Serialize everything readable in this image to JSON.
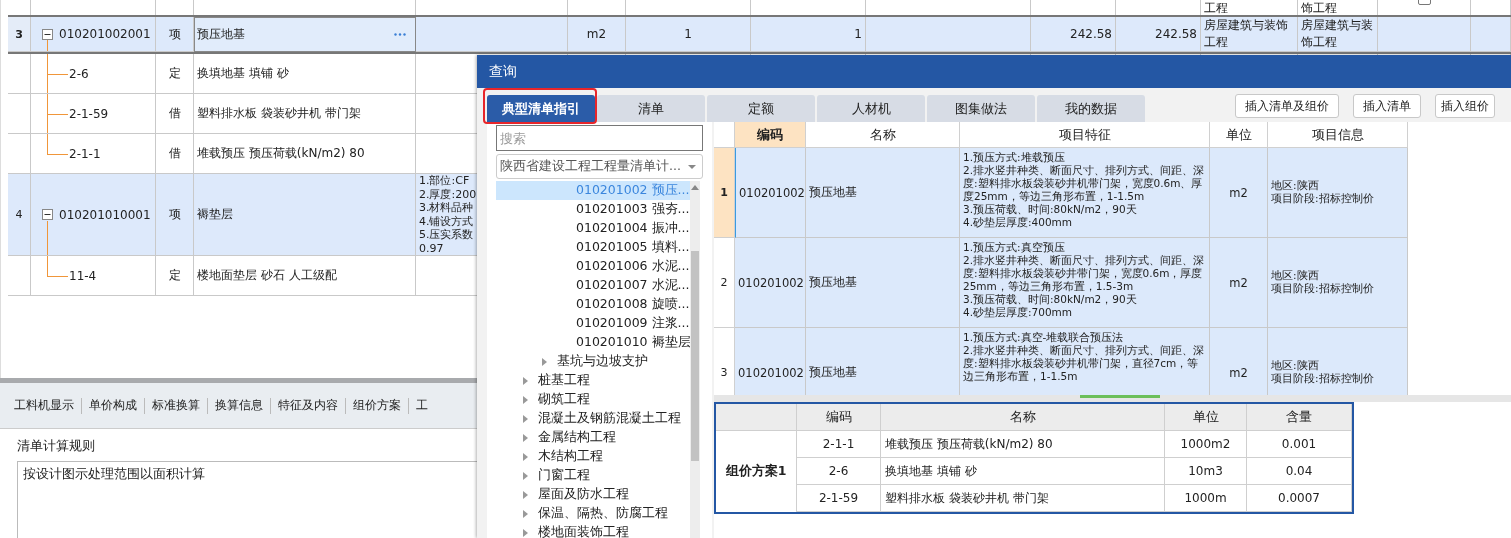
{
  "main_grid": {
    "top_row_fragment": {
      "column_12": "工程",
      "column_13": "饰工程",
      "checked": false
    },
    "rows": [
      {
        "index": "3",
        "code": "010201002001",
        "type": "项",
        "name": "预压地基",
        "kind": "bill",
        "selected": true,
        "expanded": true,
        "unit": "m2",
        "column_7": "1",
        "column_8": "1",
        "column_10": "242.58",
        "column_11": "242.58",
        "column_12": "房屋建筑与装饰工程",
        "column_13": "房屋建筑与装饰工程",
        "children": [
          {
            "code": "2-6",
            "type": "定",
            "name": "换填地基 填铺 砂",
            "kind": "quota",
            "selected": false
          },
          {
            "code": "2-1-59",
            "type": "借",
            "name": "塑料排水板 袋装砂井机 带门架",
            "kind": "quota",
            "selected": false
          },
          {
            "code": "2-1-1",
            "type": "借",
            "name": "堆载预压 预压荷载(kN/m2) 80",
            "kind": "quota",
            "selected": false
          }
        ]
      },
      {
        "index": "4",
        "code": "010201010001",
        "type": "项",
        "name": "褥垫层",
        "kind": "bill",
        "selected": false,
        "expanded": true,
        "feature": [
          "1.部位:CF",
          "2.厚度:200",
          "3.材料品种",
          "4.铺设方式",
          "5.压实系数",
          "0.97"
        ],
        "children": [
          {
            "code": "11-4",
            "type": "定",
            "name": "楼地面垫层 砂石 人工级配",
            "kind": "quota",
            "selected": false
          }
        ]
      }
    ]
  },
  "bottom_panel": {
    "tabs": [
      "工料机显示",
      "单价构成",
      "标准换算",
      "换算信息",
      "特征及内容",
      "组价方案",
      "工"
    ],
    "rule_label": "清单计算规则",
    "rule_text": "按设计图示处理范围以面积计算"
  },
  "dialog": {
    "title": "查询",
    "tabs": [
      {
        "label": "典型清单指引",
        "selected": true,
        "annotated": true
      },
      {
        "label": "清单",
        "selected": false,
        "annotated": false
      },
      {
        "label": "定额",
        "selected": false,
        "annotated": false
      },
      {
        "label": "人材机",
        "selected": false,
        "annotated": false
      },
      {
        "label": "图集做法",
        "selected": false,
        "annotated": false
      },
      {
        "label": "我的数据",
        "selected": false,
        "annotated": false
      }
    ],
    "buttons": [
      "插入清单及组价",
      "插入清单",
      "插入组价"
    ],
    "search": {
      "placeholder": "搜索"
    },
    "library_select": {
      "value": "陕西省建设工程工程量清单计..."
    },
    "tree": [
      {
        "children": [
          {
            "children": [
              {
                "label": "010201002 预压...",
                "selected": true
              },
              {
                "label": "010201003 强夯...",
                "selected": false
              },
              {
                "label": "010201004 振冲...",
                "selected": false
              },
              {
                "label": "010201005 填料...",
                "selected": false
              },
              {
                "label": "010201006 水泥...",
                "selected": false
              },
              {
                "label": "010201007 水泥...",
                "selected": false
              },
              {
                "label": "010201008 旋喷...",
                "selected": false
              },
              {
                "label": "010201009 注浆...",
                "selected": false
              },
              {
                "label": "010201010 褥垫层",
                "selected": false
              }
            ]
          },
          {
            "label": "基坑与边坡支护",
            "expanded": false,
            "selected": false
          }
        ]
      },
      {
        "label": "桩基工程",
        "expanded": false,
        "selected": false
      },
      {
        "label": "砌筑工程",
        "expanded": false,
        "selected": false
      },
      {
        "label": "混凝土及钢筋混凝土工程",
        "expanded": false,
        "selected": false
      },
      {
        "label": "金属结构工程",
        "expanded": false,
        "selected": false
      },
      {
        "label": "木结构工程",
        "expanded": false,
        "selected": false
      },
      {
        "label": "门窗工程",
        "expanded": false,
        "selected": false
      },
      {
        "label": "屋面及防水工程",
        "expanded": false,
        "selected": false
      },
      {
        "label": "保温、隔热、防腐工程",
        "expanded": false,
        "selected": false
      },
      {
        "label": "楼地面装饰工程",
        "expanded": false,
        "selected": false
      }
    ],
    "results": {
      "columns": [
        {
          "label": "编码",
          "selected": true
        },
        {
          "label": "名称",
          "selected": false
        },
        {
          "label": "项目特征",
          "selected": false
        },
        {
          "label": "单位",
          "selected": false
        },
        {
          "label": "项目信息",
          "selected": false
        }
      ],
      "rows": [
        {
          "index": "1",
          "selected": true,
          "code": "010201002",
          "name": "预压地基",
          "features": [
            "1.预压方式:堆载预压",
            "2.排水竖井种类、断面尺寸、排列方式、间距、深度:塑料排水板袋装砂井机带门架，宽度0.6m、厚度25mm，等边三角形布置，1-1.5m",
            "3.预压荷载、时间:80kN/m2，90天",
            "4.砂垫层厚度:400mm"
          ],
          "unit": "m2",
          "info": [
            "地区:陕西",
            "项目阶段:招标控制价"
          ]
        },
        {
          "index": "2",
          "selected": false,
          "code": "010201002",
          "name": "预压地基",
          "features": [
            "1.预压方式:真空预压",
            "2.排水竖井种类、断面尺寸、排列方式、间距、深度:塑料排水板袋装砂井带门架，宽度0.6m，厚度25mm，等边三角形布置，1.5-3m",
            "3.预压荷载、时间:80kN/m2，90天",
            "4.砂垫层厚度:700mm"
          ],
          "unit": "m2",
          "info": [
            "地区:陕西",
            "项目阶段:招标控制价"
          ]
        },
        {
          "index": "3",
          "selected": false,
          "code": "010201002",
          "name": "预压地基",
          "features": [
            "1.预压方式:真空-堆载联合预压法",
            "2.排水竖井种类、断面尺寸、排列方式、间距、深度:塑料排水板袋装砂井机带门架，直径7cm，等边三角形布置，1-1.5m"
          ],
          "unit": "m2",
          "info": [
            "地区:陕西",
            "项目阶段:招标控制价"
          ]
        }
      ]
    },
    "scheme": {
      "label": "组价方案1",
      "columns": [
        "编码",
        "名称",
        "单位",
        "含量"
      ],
      "rows": [
        {
          "code": "2-1-1",
          "name": "堆载预压 预压荷载(kN/m2) 80",
          "unit": "1000m2",
          "amount": "0.001"
        },
        {
          "code": "2-6",
          "name": "换填地基 填铺 砂",
          "unit": "10m3",
          "amount": "0.04"
        },
        {
          "code": "2-1-59",
          "name": "塑料排水板 袋装砂井机 带门架",
          "unit": "1000m",
          "amount": "0.0007"
        }
      ]
    }
  }
}
